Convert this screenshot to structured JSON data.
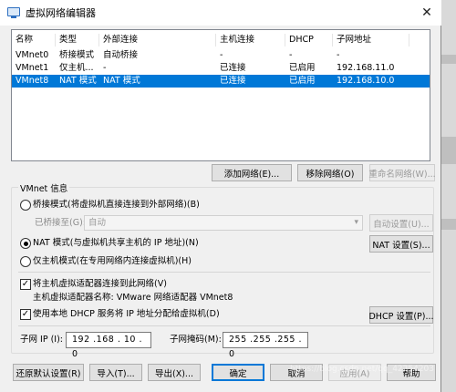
{
  "window": {
    "title": "虚拟网络编辑器",
    "close_glyph": "✕"
  },
  "table": {
    "headers": [
      "名称",
      "类型",
      "外部连接",
      "主机连接",
      "DHCP",
      "子网地址"
    ],
    "rows": [
      [
        "VMnet0",
        "桥接模式",
        "自动桥接",
        "-",
        "-",
        "-"
      ],
      [
        "VMnet1",
        "仅主机...",
        "-",
        "已连接",
        "已启用",
        "192.168.11.0"
      ],
      [
        "VMnet8",
        "NAT 模式",
        "NAT 模式",
        "已连接",
        "已启用",
        "192.168.10.0"
      ]
    ],
    "selected_index": 2
  },
  "table_buttons": {
    "add": "添加网络(E)...",
    "remove": "移除网络(O)",
    "rename": "重命名网络(W)..."
  },
  "vmnet_info": {
    "label": "VMnet 信息",
    "bridge_radio": "桥接模式(将虚拟机直接连接到外部网络)(B)",
    "bridged_to_label": "已桥接至(G):",
    "bridged_to_value": "自动",
    "auto_settings": "自动设置(U)...",
    "nat_radio": "NAT 模式(与虚拟机共享主机的 IP 地址)(N)",
    "nat_settings": "NAT 设置(S)...",
    "hostonly_radio": "仅主机模式(在专用网络内连接虚拟机)(H)",
    "connect_adapter_check": "将主机虚拟适配器连接到此网络(V)",
    "adapter_name": "主机虚拟适配器名称: VMware 网络适配器 VMnet8",
    "dhcp_check": "使用本地 DHCP 服务将 IP 地址分配给虚拟机(D)",
    "dhcp_settings": "DHCP 设置(P)...",
    "subnet_ip_label": "子网 IP (I):",
    "subnet_ip_value": "192 .168 . 10 . 0",
    "subnet_mask_label": "子网掩码(M):",
    "subnet_mask_value": "255 .255 .255 . 0",
    "selected_mode": "nat",
    "connect_adapter_checked": true,
    "dhcp_checked": true
  },
  "footer_buttons": {
    "restore": "还原默认设置(R)",
    "import": "导入(T)...",
    "export": "导出(X)...",
    "ok": "确定",
    "cancel": "取消",
    "apply": "应用(A)",
    "help": "帮助"
  },
  "watermark": "https://blog.csdn.net/qq_42254203",
  "colors": {
    "selection": "#0078d7",
    "window_bg": "#f0f0f0"
  }
}
